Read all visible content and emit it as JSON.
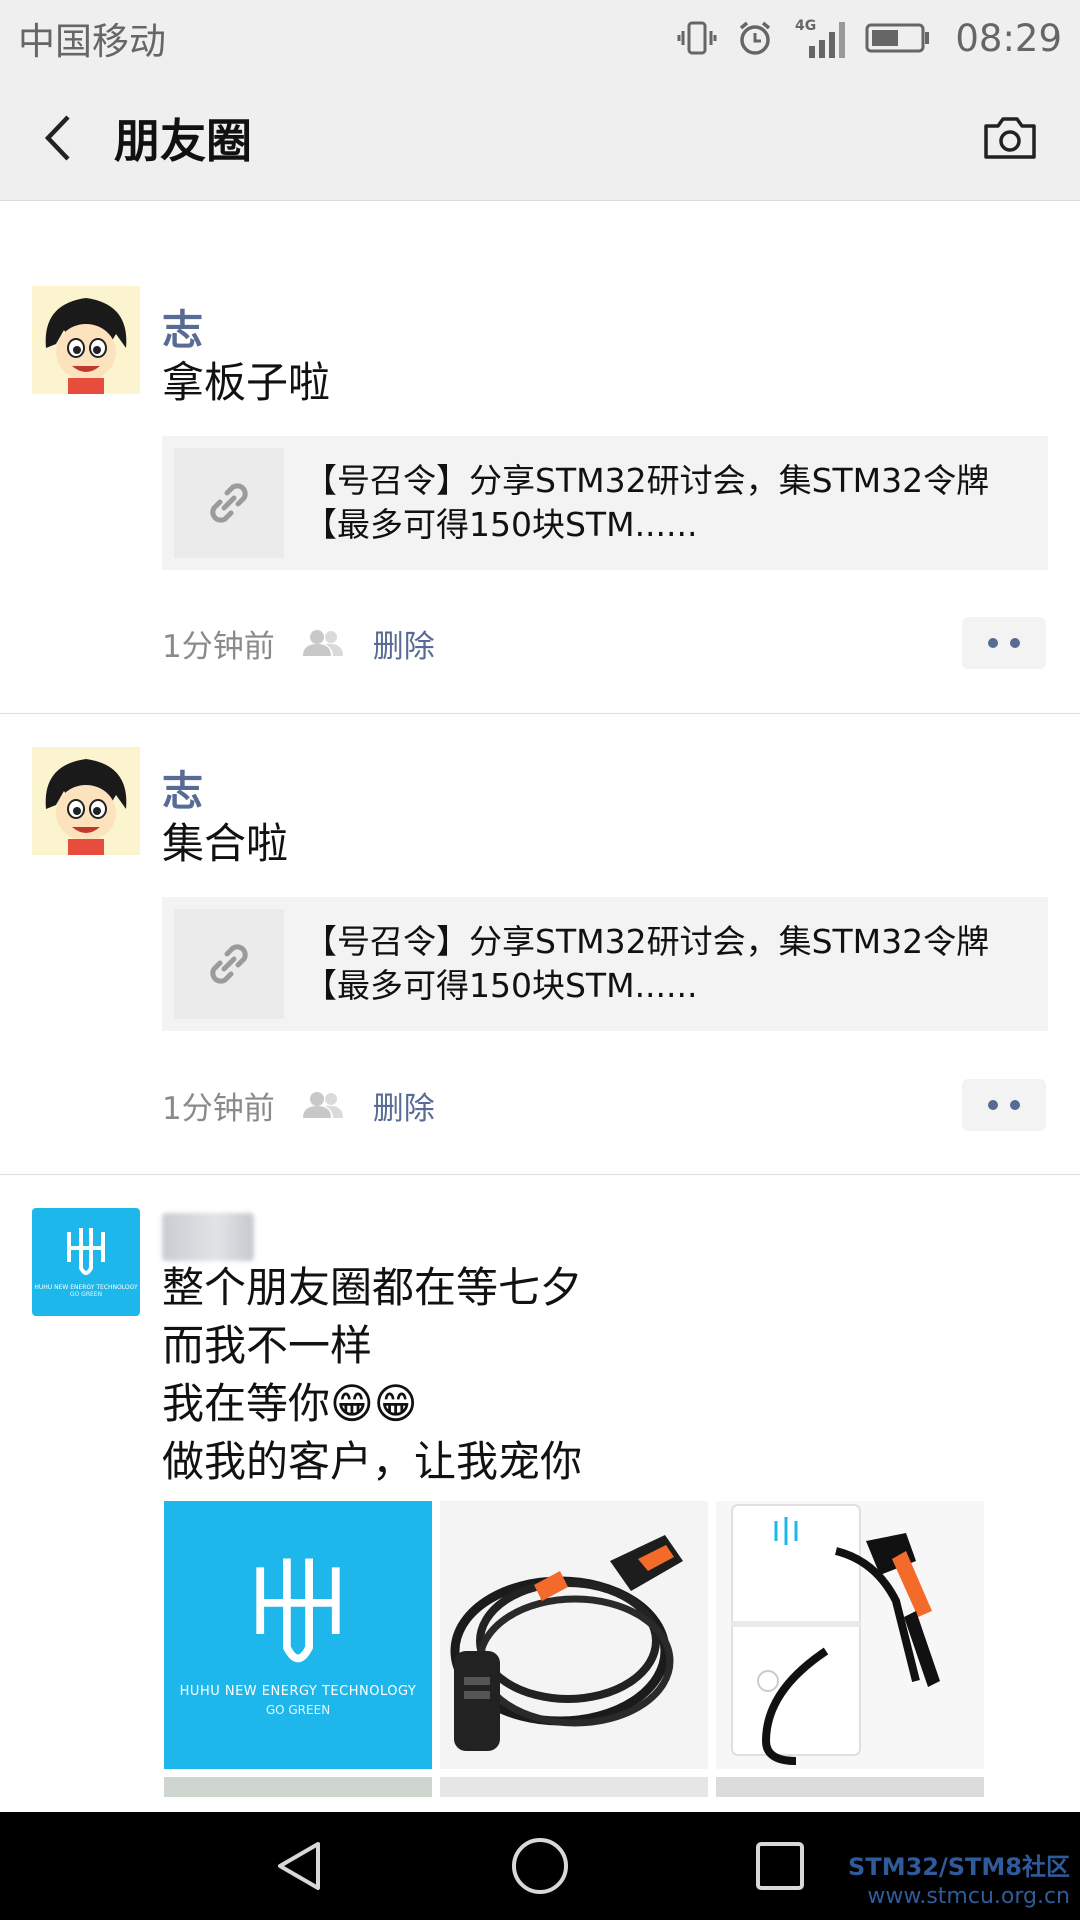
{
  "status_bar": {
    "carrier": "中国移动",
    "network": "4G",
    "time": "08:29"
  },
  "header": {
    "title": "朋友圈",
    "back_icon": "chevron-left-icon",
    "camera_icon": "camera-icon"
  },
  "posts": [
    {
      "author": "志",
      "text": "拿板子啦",
      "link": {
        "title_line1": "【号召令】分享STM32研讨会，集STM32令牌",
        "title_line2": "【最多可得150块STM......"
      },
      "time": "1分钟前",
      "delete_label": "删除"
    },
    {
      "author": "志",
      "text": "集合啦",
      "link": {
        "title_line1": "【号召令】分享STM32研讨会，集STM32令牌",
        "title_line2": "【最多可得150块STM......"
      },
      "time": "1分钟前",
      "delete_label": "删除"
    },
    {
      "author_blurred": true,
      "lines": [
        "整个朋友圈都在等七夕",
        "而我不一样",
        "我在等你😁😁",
        "做我的客户，让我宠你"
      ],
      "brand_avatar_text": "HUHU NEW ENERGY TECHNOLOGY",
      "brand_avatar_sub": "GO GREEN",
      "photo1_line1": "HUHU NEW ENERGY TECHNOLOGY",
      "photo1_line2": "GO GREEN"
    }
  ],
  "watermark": {
    "line1": "STM32/STM8社区",
    "line2": "www.stmcu.org.cn"
  },
  "colors": {
    "link_blue": "#576b95",
    "brand_cyan": "#1eb7ec",
    "header_bg": "#efefef"
  }
}
